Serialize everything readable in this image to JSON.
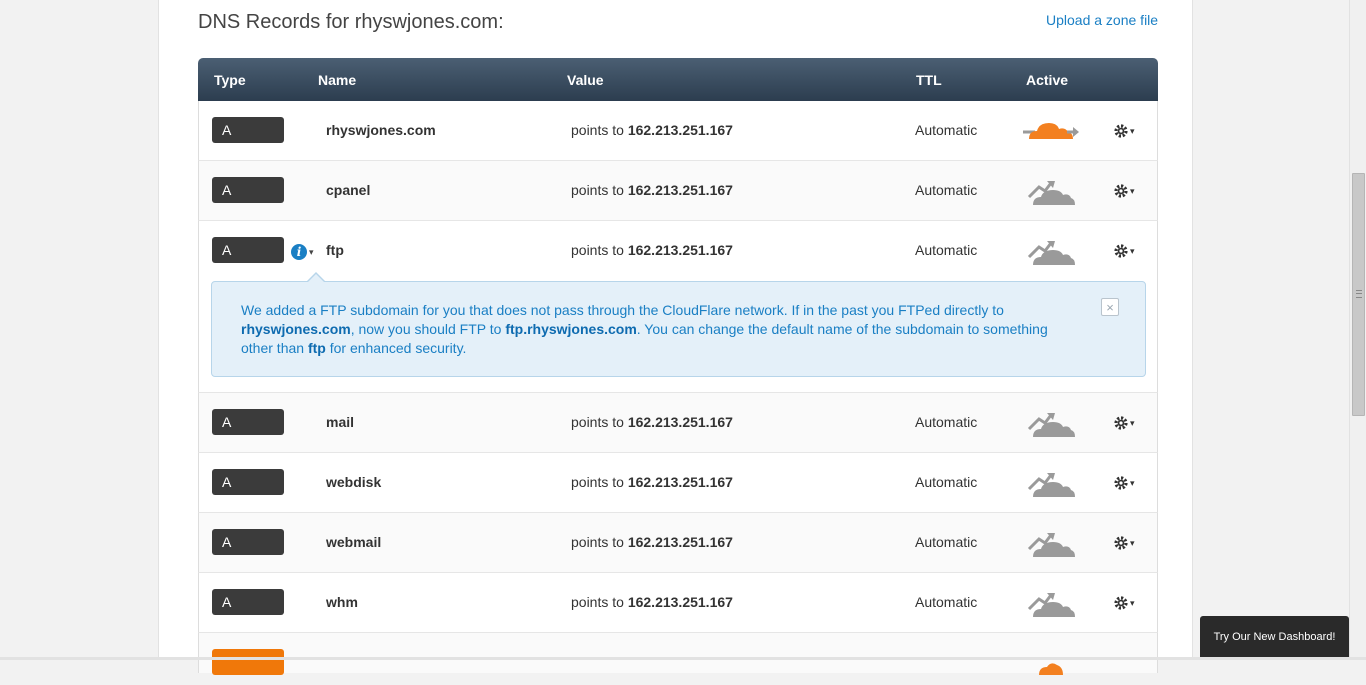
{
  "page": {
    "title": "DNS Records for rhyswjones.com:",
    "upload_link": "Upload a zone file"
  },
  "table": {
    "headers": {
      "type": "Type",
      "name": "Name",
      "value": "Value",
      "ttl": "TTL",
      "active": "Active"
    },
    "rows": [
      {
        "type": "A",
        "name": "rhyswjones.com",
        "value_prefix": "points to ",
        "value_ip": "162.213.251.167",
        "ttl": "Automatic",
        "proxy": "on"
      },
      {
        "type": "A",
        "name": "cpanel",
        "value_prefix": "points to ",
        "value_ip": "162.213.251.167",
        "ttl": "Automatic",
        "proxy": "off"
      },
      {
        "type": "A",
        "name": "ftp",
        "value_prefix": "points to ",
        "value_ip": "162.213.251.167",
        "ttl": "Automatic",
        "proxy": "off"
      },
      {
        "type": "A",
        "name": "mail",
        "value_prefix": "points to ",
        "value_ip": "162.213.251.167",
        "ttl": "Automatic",
        "proxy": "off"
      },
      {
        "type": "A",
        "name": "webdisk",
        "value_prefix": "points to ",
        "value_ip": "162.213.251.167",
        "ttl": "Automatic",
        "proxy": "off"
      },
      {
        "type": "A",
        "name": "webmail",
        "value_prefix": "points to ",
        "value_ip": "162.213.251.167",
        "ttl": "Automatic",
        "proxy": "off"
      },
      {
        "type": "A",
        "name": "whm",
        "value_prefix": "points to ",
        "value_ip": "162.213.251.167",
        "ttl": "Automatic",
        "proxy": "off"
      }
    ],
    "info_icon": "i",
    "caret": "▾"
  },
  "notice": {
    "t1": "We added a FTP subdomain for you that does not pass through the CloudFlare network. If in the past you FTPed directly to ",
    "b1": "rhyswjones.com",
    "t2": ", now you should FTP to ",
    "b2": "ftp.rhyswjones.com",
    "t3": ". You can change the default name of the subdomain to something other than ",
    "b3": "ftp",
    "t4": " for enhanced security.",
    "close": "×"
  },
  "dashboard_button": "Try Our New Dashboard!",
  "colors": {
    "cloud_on": "#f38020",
    "cloud_off": "#9a9a9a",
    "link": "#1a7fc4",
    "header_bg": "#34495e",
    "cname_badge": "#f0780a"
  },
  "icons": [
    "info-icon",
    "gear-icon",
    "cloud-on-icon",
    "cloud-off-icon",
    "close-icon"
  ]
}
